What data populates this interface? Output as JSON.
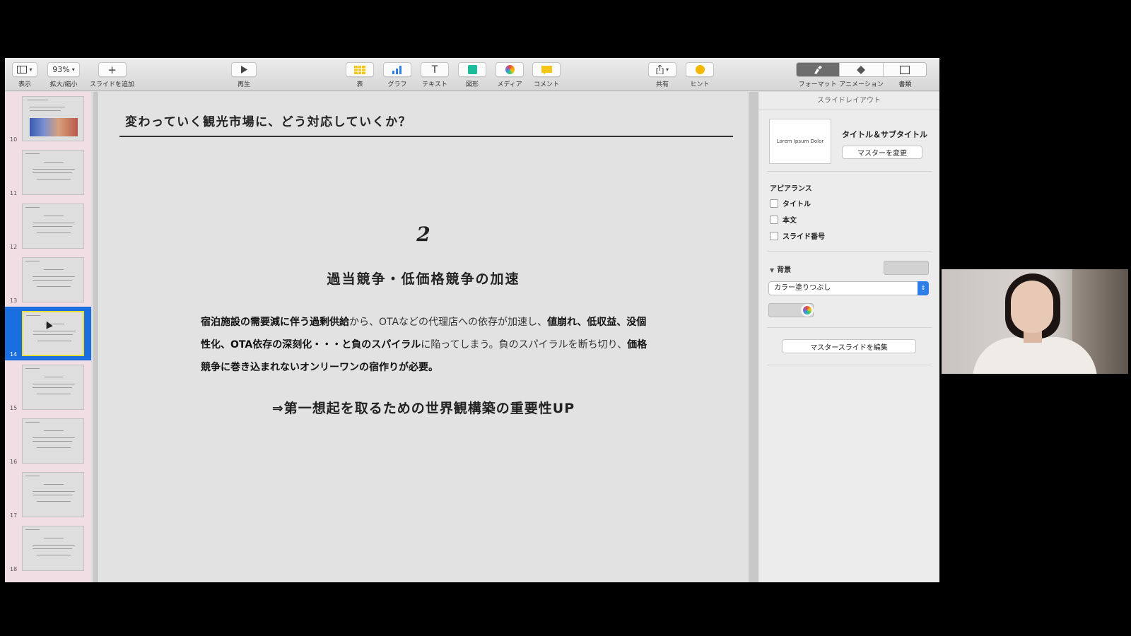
{
  "toolbar": {
    "view_label": "表示",
    "zoom_value": "93%",
    "zoom_label": "拡大/縮小",
    "add_slide_label": "スライドを追加",
    "play_label": "再生",
    "table_label": "表",
    "chart_label": "グラフ",
    "text_label": "テキスト",
    "shape_label": "図形",
    "media_label": "メディア",
    "comment_label": "コメント",
    "share_label": "共有",
    "tips_label": "ヒント",
    "format_label": "フォーマット",
    "animate_label": "アニメーション",
    "document_label": "書類"
  },
  "navigator": {
    "slides": [
      {
        "number": "10"
      },
      {
        "number": "11"
      },
      {
        "number": "12"
      },
      {
        "number": "13"
      },
      {
        "number": "14",
        "selected": true
      },
      {
        "number": "15"
      },
      {
        "number": "16"
      },
      {
        "number": "17"
      },
      {
        "number": "18"
      }
    ]
  },
  "slide": {
    "title": "変わっていく観光市場に、どう対応していくか？",
    "number": "2",
    "heading": "過当競争・低価格競争の加速",
    "body": {
      "p1_bold": "宿泊施設の需要減に伴う過剰供給",
      "p2": "から、OTAなどの代理店への依存が加速し、",
      "p3_bold": "値崩れ、低収益、没個性化、OTA依存の深刻化・・・と負のスパイラル",
      "p4": "に陥ってしまう。負のスパイラルを断ち切り、",
      "p5_bold": "価格競争に巻き込まれないオンリーワンの宿作りが必要。"
    },
    "conclusion": "⇒第一想起を取るための世界観構築の重要性UP"
  },
  "inspector": {
    "header": "スライドレイアウト",
    "layout_preview_text": "Lorem Ipsum Dolor",
    "layout_name": "タイトル＆サブタイトル",
    "change_master": "マスターを変更",
    "appearance_label": "アピアランス",
    "checkbox_title": "タイトル",
    "checkbox_body": "本文",
    "checkbox_slide_number": "スライド番号",
    "background_label": "背景",
    "fill_type": "カラー塗りつぶし",
    "edit_master": "マスタースライドを編集"
  },
  "colors": {
    "accent": "#1a6ee0",
    "navigator_bg": "#f1dde4",
    "slide_bg": "#e2e2e2"
  }
}
